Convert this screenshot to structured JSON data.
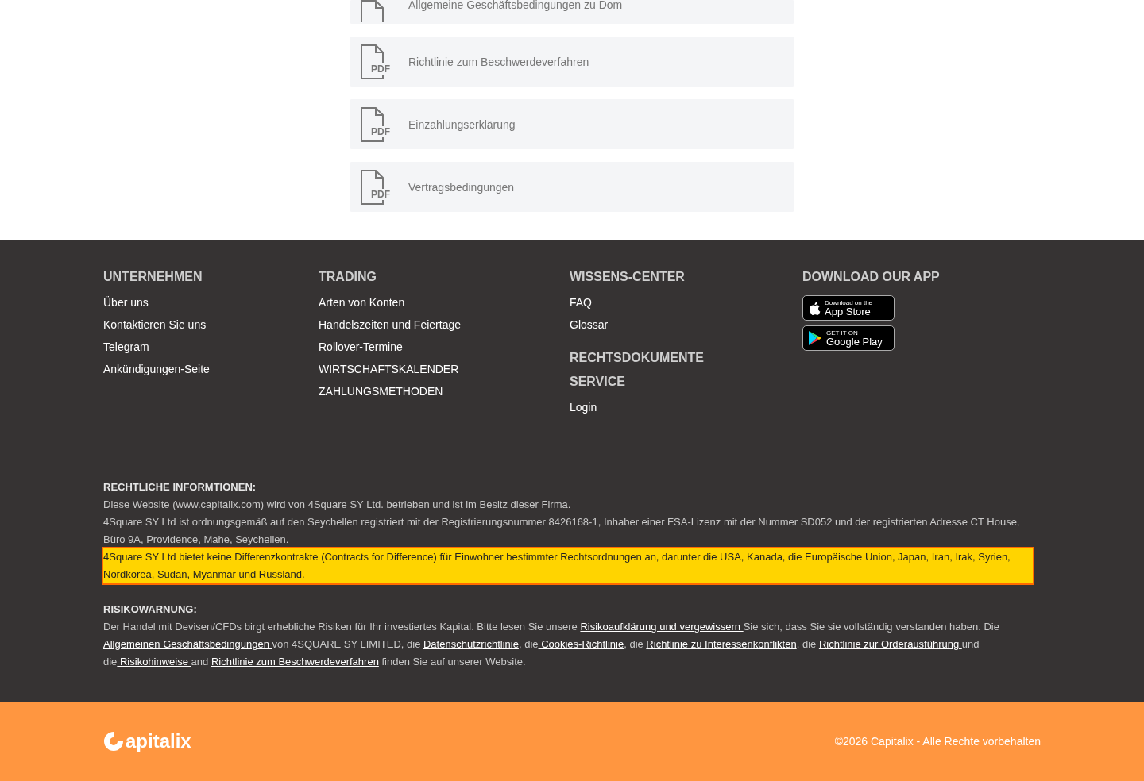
{
  "documents": [
    {
      "title": "Allgemeine Geschäftsbedingungen zu Dom"
    },
    {
      "badge": "PDF",
      "title": "Richtlinie zum Beschwerdeverfahren"
    },
    {
      "badge": "PDF",
      "title": "Einzahlungserklärung"
    },
    {
      "badge": "PDF",
      "title": "Vertragsbedingungen"
    }
  ],
  "footer": {
    "columns": [
      {
        "sections": [
          {
            "heading": "UNTERNEHMEN",
            "links": [
              "Über uns",
              "Kontaktieren Sie uns",
              "Telegram",
              "Ankündigungen-Seite"
            ]
          }
        ]
      },
      {
        "sections": [
          {
            "heading": "TRADING",
            "links": [
              "Arten von Konten",
              "Handelszeiten und Feiertage",
              "Rollover-Termine",
              "WIRTSCHAFTSKALENDER",
              "ZAHLUNGSMETHODEN"
            ]
          }
        ]
      },
      {
        "sections": [
          {
            "heading": "WISSENS-CENTER",
            "links": [
              "FAQ",
              "Glossar"
            ]
          },
          {
            "heading": "RECHTSDOKUMENTE"
          },
          {
            "heading": "SERVICE",
            "links": [
              "Login"
            ]
          }
        ]
      },
      {
        "heading": "DOWNLOAD OUR APP",
        "apps": [
          {
            "kind": "apple",
            "small": "Download on the",
            "big": "App Store"
          },
          {
            "kind": "google",
            "small": "GET IT ON",
            "big": "Google Play"
          }
        ]
      }
    ],
    "legal": {
      "heading": "RECHTLICHE INFORMTIONEN:",
      "paragraphs": [
        {
          "text": "Diese Website (www.capitalix.com) wird von 4Square SY Ltd. betrieben und ist im Besitz dieser Firma.",
          "highlighted": false
        },
        {
          "text": "4Square SY Ltd ist ordnungsgemäß auf den Seychellen registriert mit der Registrierungsnummer 8426168-1, Inhaber einer FSA-Lizenz mit der Nummer SD052 und der registrierten Adresse CT House, Büro 9A, Providence, Mahe, Seychellen.",
          "highlighted": false
        },
        {
          "text": "4Square SY Ltd bietet keine Differenzkontrakte (Contracts for Difference) für Einwohner bestimmter Rechtsordnungen an, darunter die USA, Kanada, die Europäische Union, Japan, Iran, Irak, Syrien, Nordkorea, Sudan, Myanmar und Russland.",
          "highlighted": true
        }
      ]
    },
    "risk": {
      "heading": "RISIKOWARNUNG:",
      "segments": [
        {
          "text": "Der Handel mit Devisen/CFDs birgt erhebliche Risiken für Ihr investiertes Kapital. Bitte lesen Sie unsere ",
          "kind": "text"
        },
        {
          "text": "Risikoaufklärung und vergewissern ",
          "kind": "link"
        },
        {
          "text": "Sie sich, dass Sie sie vollständig verstanden haben. Die ",
          "kind": "text"
        },
        {
          "text": "Allgemeinen Geschäftsbedingungen ",
          "kind": "link"
        },
        {
          "text": "von 4SQUARE SY LIMITED, die ",
          "kind": "text"
        },
        {
          "text": "Datenschutzrichtlinie",
          "kind": "link"
        },
        {
          "text": ", die",
          "kind": "text"
        },
        {
          "text": " Cookies-Richtlinie",
          "kind": "link"
        },
        {
          "text": ", die ",
          "kind": "text"
        },
        {
          "text": "Richtlinie zu Interessenkonflikten",
          "kind": "link"
        },
        {
          "text": ", die ",
          "kind": "text"
        },
        {
          "text": "Richtlinie zur Orderausführung ",
          "kind": "link"
        },
        {
          "text": "und die",
          "kind": "text"
        },
        {
          "text": " Risikohinweise ",
          "kind": "link"
        },
        {
          "text": "and ",
          "kind": "text"
        },
        {
          "text": "Richtlinie zum Beschwerdeverfahren",
          "kind": "link"
        },
        {
          "text": " finden Sie auf unserer Website.",
          "kind": "text"
        }
      ]
    }
  },
  "bottom_bar": {
    "logo": "apitalix",
    "copyright": "©2026 Capitalix - Alle Rechte vorbehalten"
  }
}
